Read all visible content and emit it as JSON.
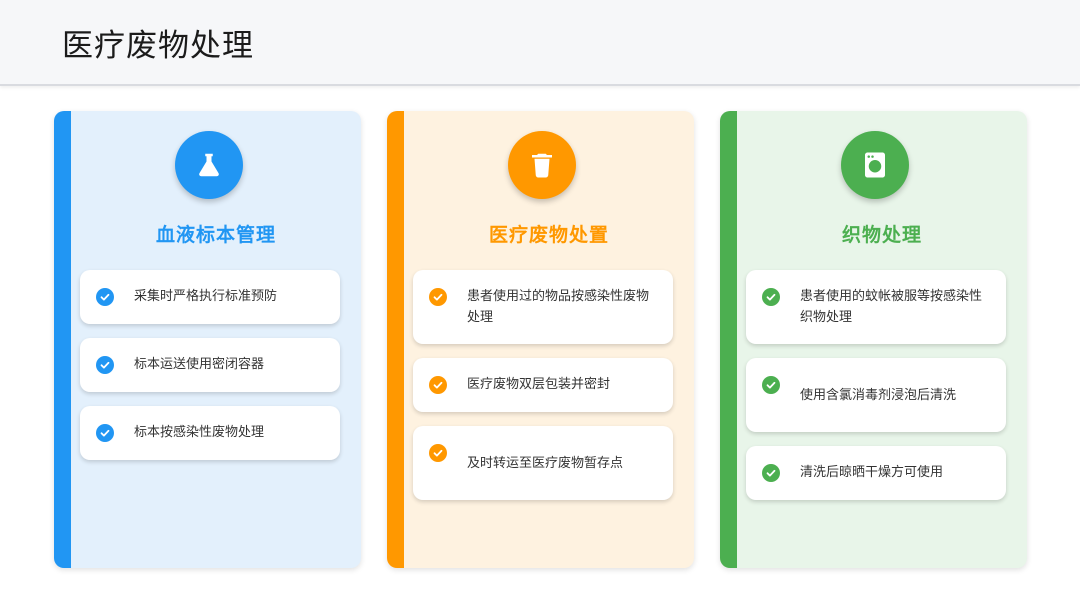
{
  "page": {
    "title": "医疗废物处理"
  },
  "colors": {
    "blue": "#2196f3",
    "orange": "#ff9800",
    "green": "#4caf50"
  },
  "cards": [
    {
      "icon": "flask-icon",
      "title": "血液标本管理",
      "items": [
        "采集时严格执行标准预防",
        "标本运送使用密闭容器",
        "标本按感染性废物处理"
      ]
    },
    {
      "icon": "trash-icon",
      "title": "医疗废物处置",
      "items": [
        "患者使用过的物品按感染性废物处理",
        "医疗废物双层包装并密封",
        "及时转运至医疗废物暂存点"
      ]
    },
    {
      "icon": "washing-machine-icon",
      "title": "织物处理",
      "items": [
        "患者使用的蚊帐被服等按感染性织物处理",
        "使用含氯消毒剂浸泡后清洗",
        "清洗后晾晒干燥方可使用"
      ]
    }
  ]
}
